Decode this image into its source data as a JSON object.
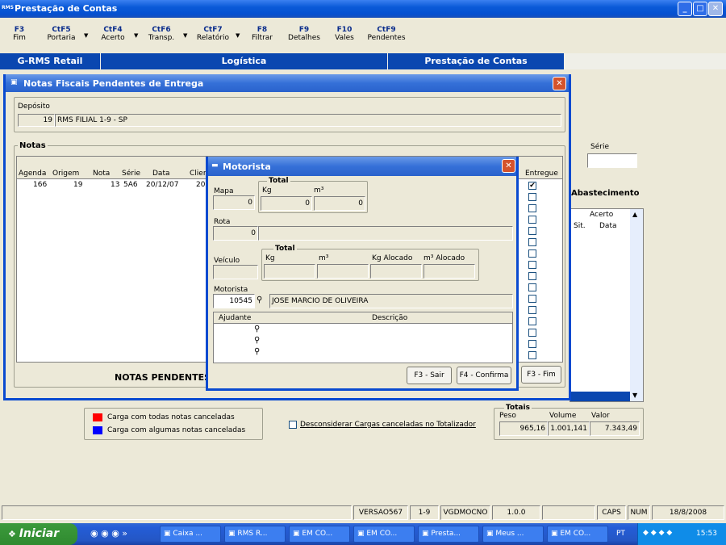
{
  "app": {
    "title": "Prestação de Contas",
    "logo": "RMS"
  },
  "toolbar": [
    {
      "key": "F3",
      "label": "Fim"
    },
    {
      "key": "CtF5",
      "label": "Portaria"
    },
    {
      "key": "CtF4",
      "label": "Acerto"
    },
    {
      "key": "CtF6",
      "label": "Transp."
    },
    {
      "key": "CtF7",
      "label": "Relatório"
    },
    {
      "key": "F8",
      "label": "Filtrar"
    },
    {
      "key": "F9",
      "label": "Detalhes"
    },
    {
      "key": "F10",
      "label": "Vales"
    },
    {
      "key": "CtF9",
      "label": "Pendentes"
    }
  ],
  "bluebar": {
    "a": "G-RMS Retail",
    "b": "Logística",
    "c": "Prestação de Contas"
  },
  "notas_window": {
    "title": "Notas Fiscais Pendentes de Entrega",
    "deposito_label": "Depósito",
    "deposito_code": "19",
    "deposito_name": "RMS FILIAL 1-9 - SP",
    "notas_label": "Notas",
    "columns": [
      "Agenda",
      "Origem",
      "Nota",
      "Série",
      "Data",
      "Clien",
      "Entregue"
    ],
    "row": [
      "166",
      "19",
      "13",
      "5A6",
      "20/12/07",
      "200"
    ],
    "footer": "NOTAS PENDENTES",
    "fim_btn": "F3 - Fim"
  },
  "back": {
    "serie_label": "Série",
    "abastecimento": "Abastecimento",
    "acerto": "Acerto",
    "sit": "Sit.",
    "data": "Data"
  },
  "motorista": {
    "title": "Motorista",
    "total_label": "Total",
    "kg": "Kg",
    "m3": "m³",
    "mapa": "Mapa",
    "mapa_val": "0",
    "kg_val": "0",
    "m3_val": "0",
    "rota": "Rota",
    "rota_val": "0",
    "veiculo": "Veículo",
    "kg_alocado": "Kg Alocado",
    "m3_alocado": "m³ Alocado",
    "motorista_label": "Motorista",
    "motorista_code": "10545",
    "motorista_name": "JOSE MARCIO DE OLIVEIRA",
    "ajudante": "Ajudante",
    "descricao": "Descrição",
    "sair": "F3 - Sair",
    "confirma": "F4 - Confirma"
  },
  "legend": {
    "red": "Carga com todas notas canceladas",
    "blue": "Carga com algumas notas canceladas",
    "red_color": "#ff0000",
    "blue_color": "#0000ff"
  },
  "desconsiderar": "Desconsiderar Cargas canceladas no Totalizador",
  "totais": {
    "label": "Totais",
    "peso": "Peso",
    "volume": "Volume",
    "valor": "Valor",
    "peso_val": "965,16",
    "volume_val": "1.001,141",
    "valor_val": "7.343,49"
  },
  "status": [
    "VERSAO567",
    "1-9",
    "VGDMOCNO",
    "1.0.0",
    "CAPS",
    "NUM",
    "18/8/2008"
  ],
  "taskbar": {
    "start": "Iniciar",
    "tasks": [
      "Caixa ...",
      "RMS R...",
      "EM CO...",
      "EM CO...",
      "Presta...",
      "Meus ...",
      "EM CO..."
    ],
    "lang": "PT",
    "clock": "15:53"
  }
}
